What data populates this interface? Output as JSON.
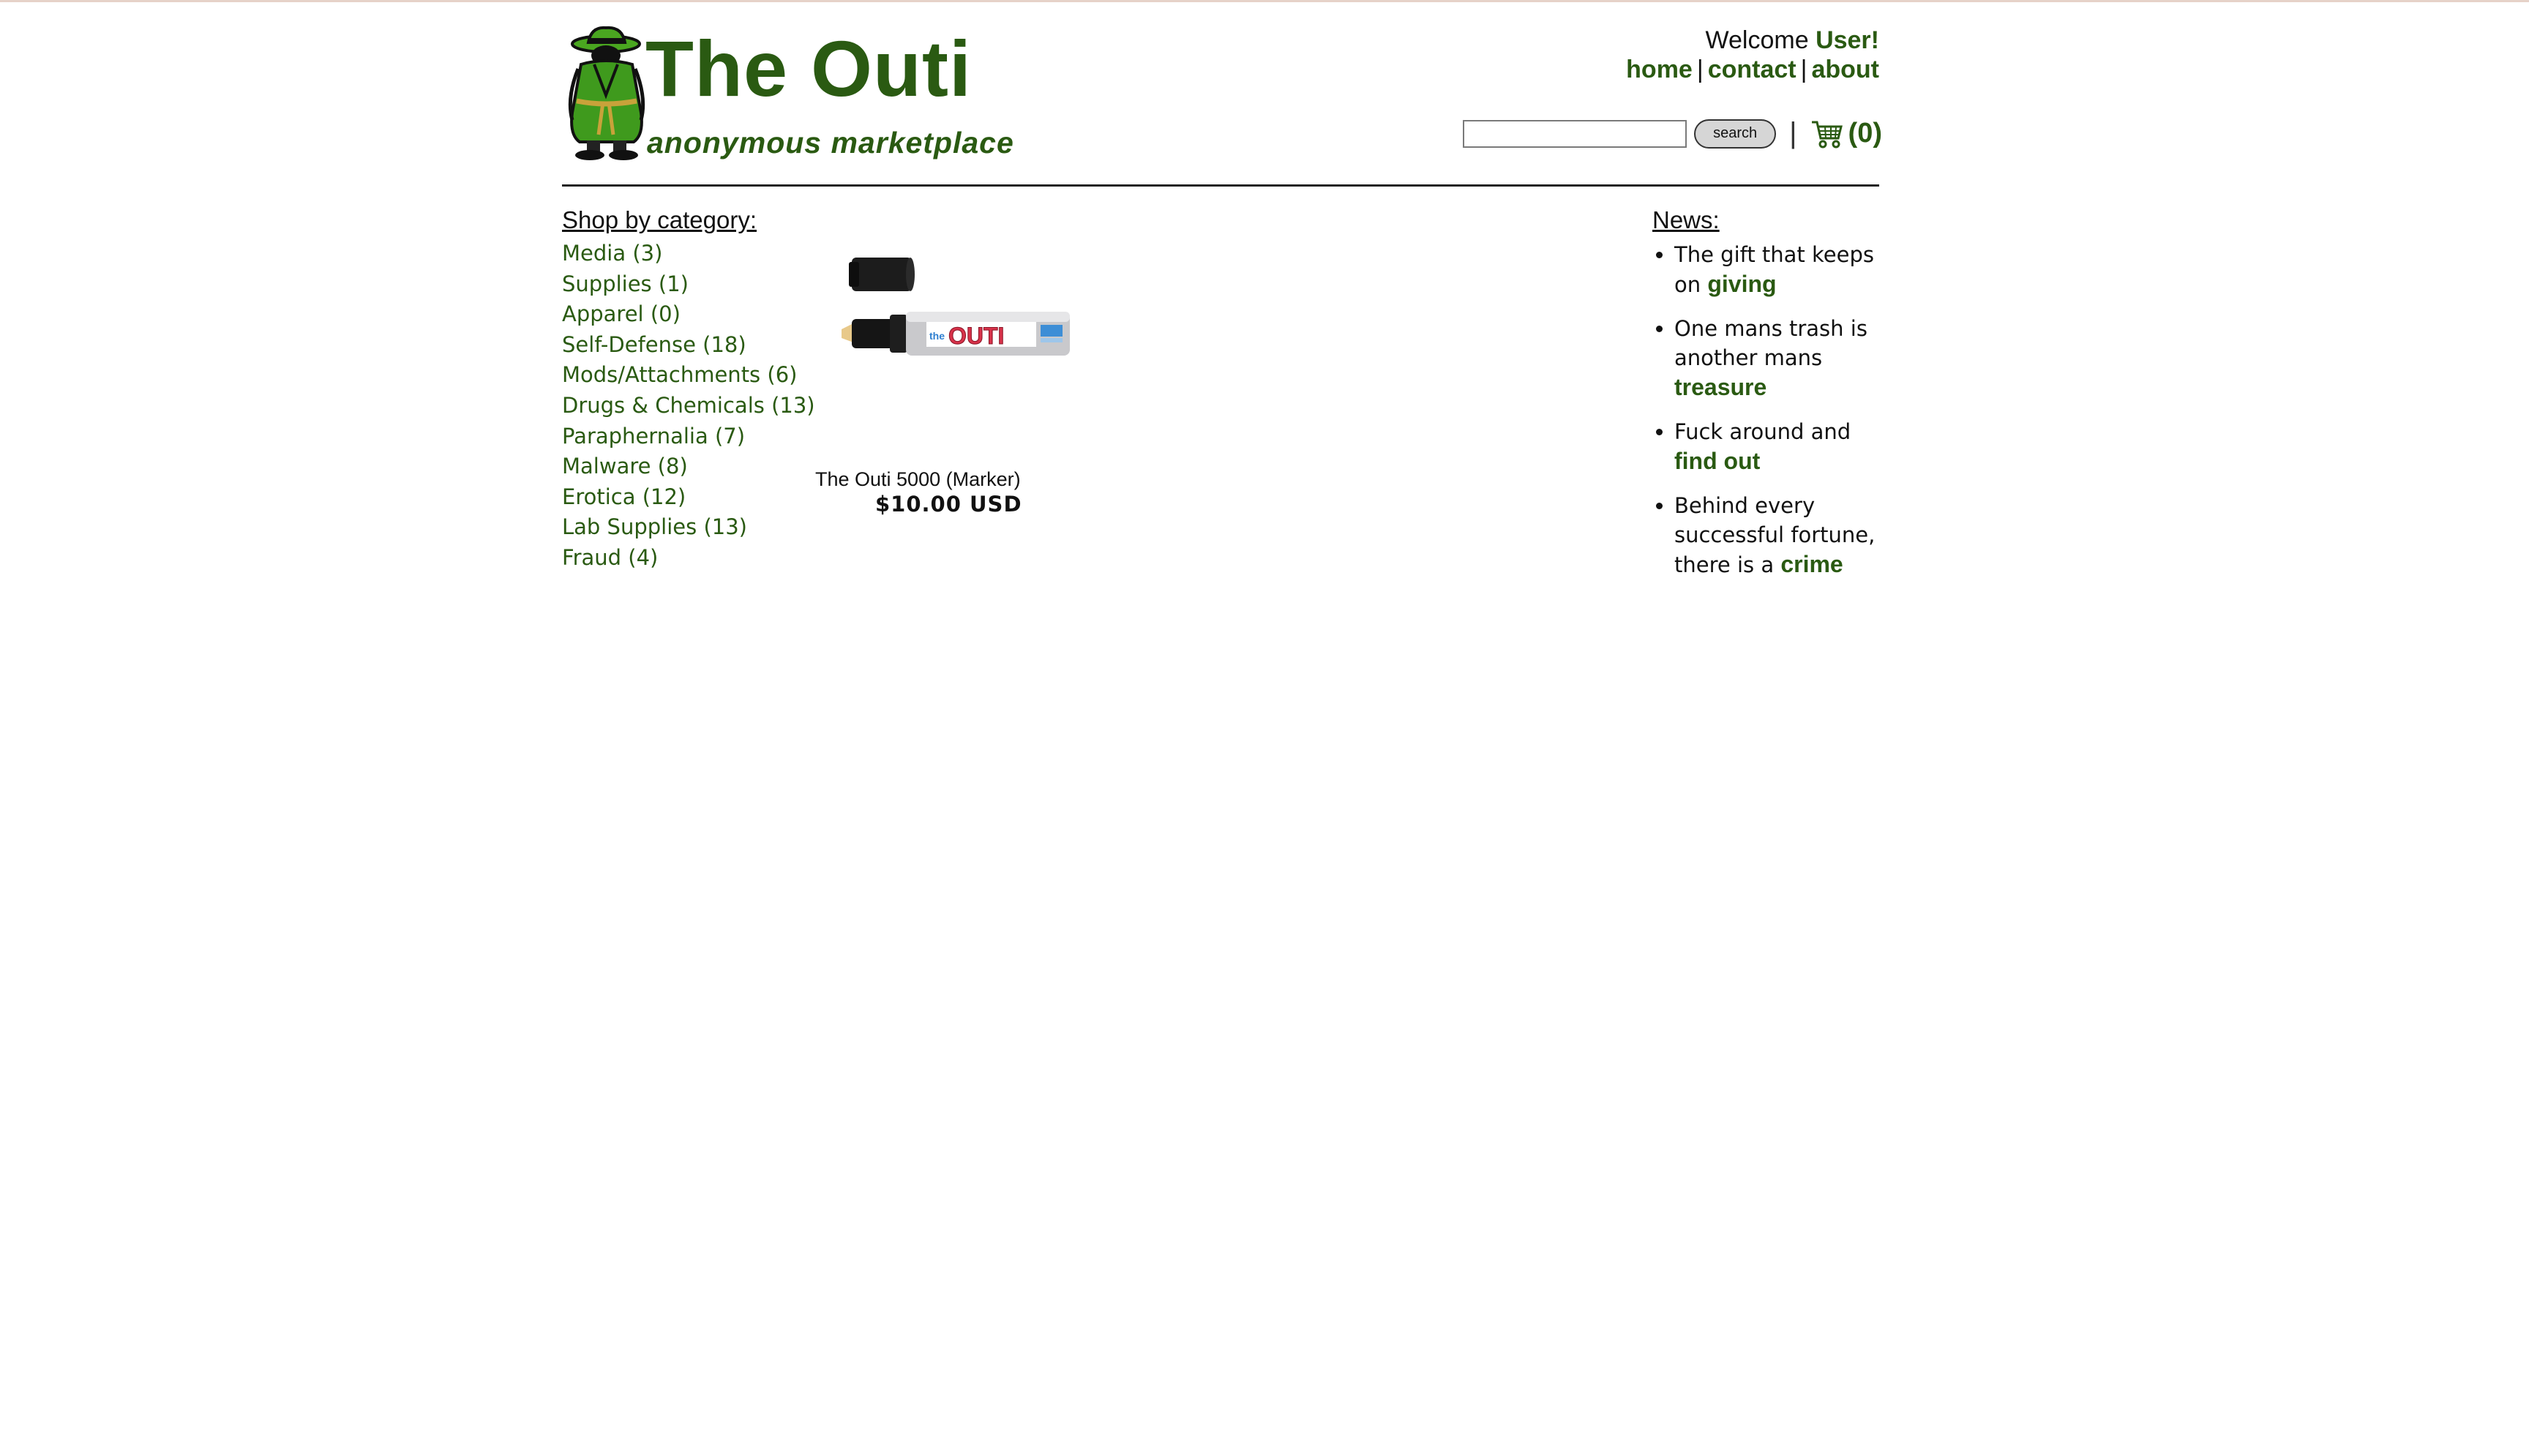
{
  "header": {
    "logo_title": "The Outi",
    "logo_tagline": "anonymous marketplace",
    "welcome_text": "Welcome ",
    "welcome_user": "User",
    "welcome_suffix": "!"
  },
  "nav": {
    "home": "home",
    "contact": "contact",
    "about": "about",
    "separator": "|"
  },
  "search": {
    "placeholder": "",
    "value": "",
    "button_label": "search"
  },
  "cart": {
    "count_label": "(0)"
  },
  "categories": {
    "heading": "Shop by category:",
    "items": [
      "Media (3)",
      "Supplies (1)",
      "Apparel (0)",
      "Self-Defense (18)",
      "Mods/Attachments (6)",
      "Drugs & Chemicals (13)",
      "Paraphernalia (7)",
      "Malware (8)",
      "Erotica (12)",
      "Lab Supplies (13)",
      "Fraud (4)"
    ]
  },
  "product": {
    "name": "The Outi 5000 (Marker)",
    "price": "$10.00 USD",
    "image_text_small": "the",
    "image_text_big": "OUTI"
  },
  "news": {
    "heading": "News:",
    "items": [
      {
        "text": "The gift that keeps on ",
        "highlight": "giving"
      },
      {
        "text": "One mans trash is another mans ",
        "highlight": "treasure"
      },
      {
        "text": "Fuck around and ",
        "highlight": "find out"
      },
      {
        "text": "Behind every successful fortune, there is a ",
        "highlight": "crime"
      }
    ]
  },
  "colors": {
    "brand_green": "#2a5a12",
    "logo_green": "#3f9a1d"
  }
}
